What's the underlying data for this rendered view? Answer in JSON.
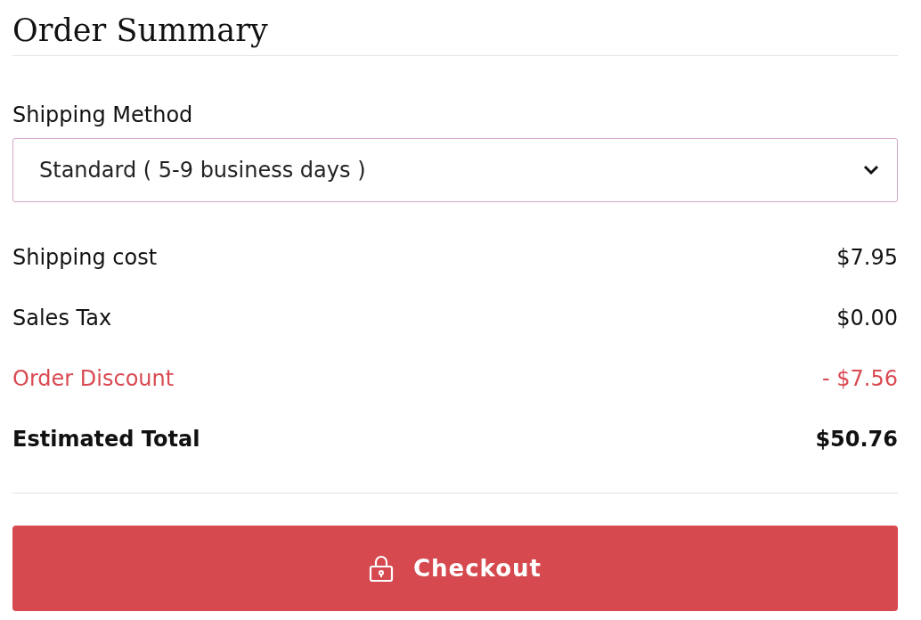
{
  "title": "Order Summary",
  "shipping_method": {
    "label": "Shipping Method",
    "value": "Standard ( 5-9 business days )"
  },
  "rows": [
    {
      "kind": "normal",
      "label": "Shipping cost",
      "amount": "$7.95"
    },
    {
      "kind": "normal",
      "label": "Sales Tax",
      "amount": "$0.00"
    },
    {
      "kind": "discount",
      "label": "Order Discount",
      "amount": "- $7.56"
    },
    {
      "kind": "total",
      "label": "Estimated Total",
      "amount": "$50.76"
    }
  ],
  "checkout_button": {
    "label": "Checkout"
  }
}
